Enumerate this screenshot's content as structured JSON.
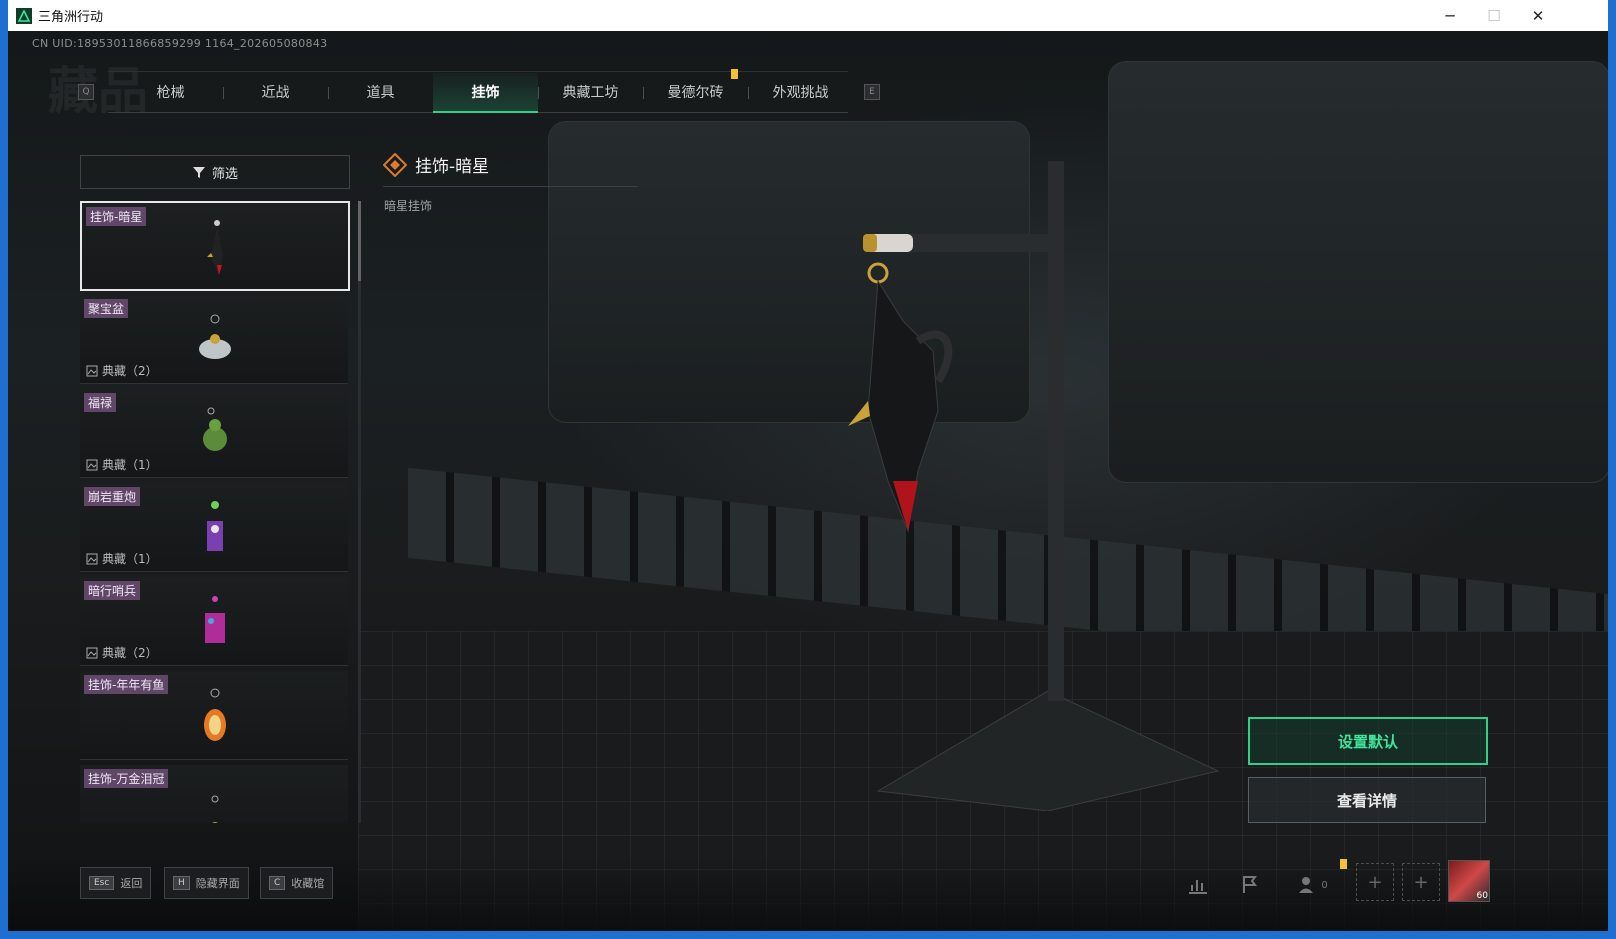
{
  "window": {
    "title": "三角洲行动",
    "minimize": "─",
    "maximize": "☐",
    "close": "✕"
  },
  "uid": "CN UID:18953011866859299 1164_202605080843",
  "tabs": [
    {
      "label": "枪械",
      "active": false
    },
    {
      "label": "近战",
      "active": false
    },
    {
      "label": "道具",
      "active": false
    },
    {
      "label": "挂饰",
      "active": true
    },
    {
      "label": "典藏工坊",
      "active": false
    },
    {
      "label": "曼德尔砖",
      "active": false
    },
    {
      "label": "外观挑战",
      "active": false
    }
  ],
  "tab_keys": {
    "prev": "Q",
    "next": "E"
  },
  "filter_label": "筛选",
  "items": [
    {
      "name": "挂饰-暗星",
      "collection": ""
    },
    {
      "name": "聚宝盆",
      "collection": "典藏（2）"
    },
    {
      "name": "福禄",
      "collection": "典藏（1）"
    },
    {
      "name": "崩岩重炮",
      "collection": "典藏（1）"
    },
    {
      "name": "暗行哨兵",
      "collection": "典藏（2）"
    },
    {
      "name": "挂饰-年年有鱼",
      "collection": ""
    },
    {
      "name": "挂饰-万金泪冠",
      "collection": ""
    }
  ],
  "detail": {
    "title": "挂饰-暗星",
    "description": "暗星挂饰"
  },
  "buttons": {
    "set_default": "设置默认",
    "view_details": "查看详情"
  },
  "hints": [
    {
      "key": "Esc",
      "label": "返回"
    },
    {
      "key": "H",
      "label": "隐藏界面"
    },
    {
      "key": "C",
      "label": "收藏馆"
    }
  ],
  "friends_count": "0",
  "player_level": "60",
  "colors": {
    "accent": "#2fd08a",
    "notification": "#f2c230"
  }
}
